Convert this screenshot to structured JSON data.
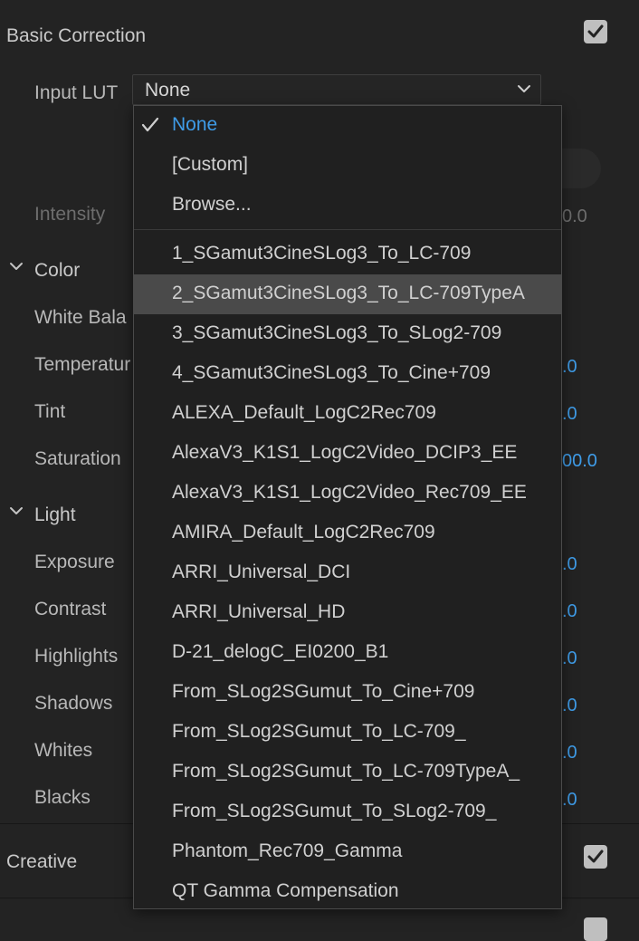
{
  "panel": {
    "basic_correction_title": "Basic Correction",
    "input_lut_label": "Input LUT",
    "input_lut_value": "None",
    "intensity_label": "Intensity",
    "intensity_value": "0.0",
    "creative_title": "Creative"
  },
  "color_section": {
    "title": "Color",
    "rows": [
      {
        "label": "White Bala",
        "value": ""
      },
      {
        "label": "Temperatur",
        "value": ".0"
      },
      {
        "label": "Tint",
        "value": ".0"
      },
      {
        "label": "Saturation",
        "value": "00.0"
      }
    ]
  },
  "light_section": {
    "title": "Light",
    "rows": [
      {
        "label": "Exposure",
        "value": ".0"
      },
      {
        "label": "Contrast",
        "value": ".0"
      },
      {
        "label": "Highlights",
        "value": ".0"
      },
      {
        "label": "Shadows",
        "value": ".0"
      },
      {
        "label": "Whites",
        "value": ".0"
      },
      {
        "label": "Blacks",
        "value": ".0"
      }
    ]
  },
  "dropdown": {
    "selected": "None",
    "highlighted_index": 4,
    "items": [
      "None",
      "[Custom]",
      "Browse...",
      "1_SGamut3CineSLog3_To_LC-709",
      "2_SGamut3CineSLog3_To_LC-709TypeA",
      "3_SGamut3CineSLog3_To_SLog2-709",
      "4_SGamut3CineSLog3_To_Cine+709",
      "ALEXA_Default_LogC2Rec709",
      "AlexaV3_K1S1_LogC2Video_DCIP3_EE",
      "AlexaV3_K1S1_LogC2Video_Rec709_EE",
      "AMIRA_Default_LogC2Rec709",
      "ARRI_Universal_DCI",
      "ARRI_Universal_HD",
      "D-21_delogC_EI0200_B1",
      "From_SLog2SGumut_To_Cine+709",
      "From_SLog2SGumut_To_LC-709_",
      "From_SLog2SGumut_To_LC-709TypeA_",
      "From_SLog2SGumut_To_SLog2-709_",
      "Phantom_Rec709_Gamma",
      "QT Gamma Compensation"
    ]
  },
  "colors": {
    "accent": "#3f9ce8",
    "background": "#232323",
    "highlight": "#4a4a4a"
  },
  "icons": {
    "checkbox": "checkmark-icon",
    "dropdown": "chevron-down-icon",
    "section_toggle": "chevron-down-icon",
    "selected_item": "checkmark-icon"
  }
}
